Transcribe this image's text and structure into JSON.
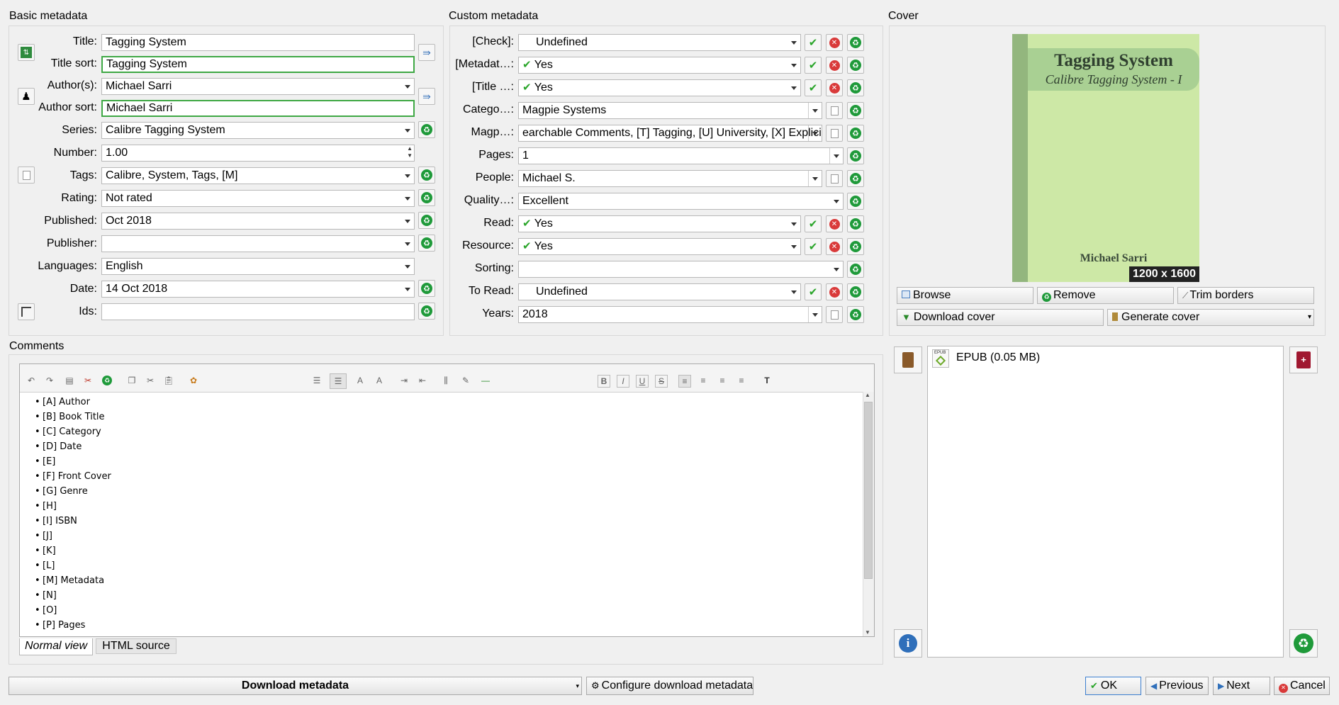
{
  "sections": {
    "basic": "Basic metadata",
    "custom": "Custom metadata",
    "cover": "Cover",
    "comments": "Comments"
  },
  "basic": {
    "title_label": "Title:",
    "title_value": "Tagging System",
    "title_sort_label": "Title sort:",
    "title_sort_value": "Tagging System",
    "authors_label": "Author(s):",
    "authors_value": "Michael Sarri",
    "author_sort_label": "Author sort:",
    "author_sort_value": "Michael Sarri",
    "series_label": "Series:",
    "series_value": "Calibre Tagging System",
    "number_label": "Number:",
    "number_value": "1.00",
    "tags_label": "Tags:",
    "tags_value": "Calibre, System, Tags, [M]",
    "rating_label": "Rating:",
    "rating_value": "Not rated",
    "published_label": "Published:",
    "published_value": "Oct 2018",
    "publisher_label": "Publisher:",
    "publisher_value": "",
    "languages_label": "Languages:",
    "languages_value": "English",
    "date_label": "Date:",
    "date_value": "14 Oct 2018",
    "ids_label": "Ids:",
    "ids_value": ""
  },
  "custom": {
    "check_label": "[Check]:",
    "check_value": "Undefined",
    "metadat_label": "[Metadat…:",
    "metadat_value": "Yes",
    "title_label": "[Title …:",
    "title_value": "Yes",
    "catego_label": "Catego…:",
    "catego_value": "Magpie Systems",
    "magp_label": "Magp…:",
    "magp_value": "earchable Comments, [T] Tagging, [U] University, [X] Explicit",
    "pages_label": "Pages:",
    "pages_value": "1",
    "people_label": "People:",
    "people_value": "Michael S.",
    "quality_label": "Quality…:",
    "quality_value": "Excellent",
    "read_label": "Read:",
    "read_value": "Yes",
    "resource_label": "Resource:",
    "resource_value": "Yes",
    "sorting_label": "Sorting:",
    "sorting_value": "",
    "toread_label": "To Read:",
    "toread_value": "Undefined",
    "years_label": "Years:",
    "years_value": "2018"
  },
  "cover": {
    "book_title": "Tagging System",
    "book_subtitle": "Calibre Tagging System - I",
    "book_author": "Michael Sarri",
    "dimensions": "1200 x 1600",
    "bg_color": "#cde8a6",
    "spine_color": "#93b67e",
    "browse": "Browse",
    "remove": "Remove",
    "trim": "Trim borders",
    "download_cover": "Download cover",
    "generate_cover": "Generate cover"
  },
  "formats": {
    "epub_label": "EPUB (0.05 MB)"
  },
  "comments": {
    "items": [
      "[A] Author",
      "[B] Book Title",
      "[C] Category",
      "[D] Date",
      "[E]",
      "[F] Front Cover",
      "[G] Genre",
      "[H]",
      "[I] ISBN",
      "[J]",
      "[K]",
      "[L]",
      "[M] Metadata",
      "[N]",
      "[O]",
      "[P] Pages"
    ],
    "tab_normal": "Normal view",
    "tab_html": "HTML source"
  },
  "bottom": {
    "download_metadata": "Download metadata",
    "configure": "Configure download metadata",
    "ok": "OK",
    "previous": "Previous",
    "next": "Next",
    "cancel": "Cancel"
  },
  "icons": [
    "refresh-icon",
    "person-icon",
    "arrow-right-icon",
    "recycle-icon",
    "check-icon",
    "x-icon",
    "document-icon",
    "book-icon",
    "info-icon",
    "delete-book-icon"
  ]
}
